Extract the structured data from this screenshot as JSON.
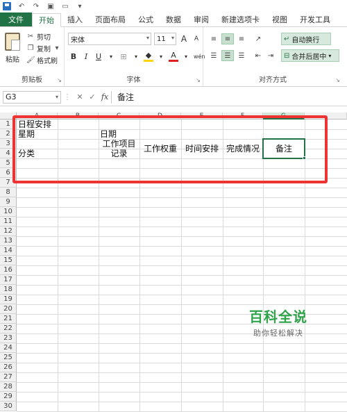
{
  "ribbon_tabs": [
    "文件",
    "开始",
    "插入",
    "页面布局",
    "公式",
    "数据",
    "审阅",
    "新建选项卡",
    "视图",
    "开发工具"
  ],
  "clipboard": {
    "paste_label": "粘贴",
    "cut_label": "剪切",
    "copy_label": "复制",
    "format_painter_label": "格式刷",
    "group_label": "剪贴板"
  },
  "font": {
    "font_name": "宋体",
    "font_size": "11",
    "bold": "B",
    "italic": "I",
    "underline": "U",
    "grow": "A",
    "shrink": "A",
    "font_color_glyph": "A",
    "phonetic": "wén",
    "group_label": "字体"
  },
  "alignment": {
    "wrap_text_label": "自动换行",
    "merge_center_label": "合并后居中",
    "group_label": "对齐方式"
  },
  "formula_bar": {
    "name_box": "G3",
    "cancel": "✕",
    "confirm": "✓",
    "fx": "fx",
    "content": "备注"
  },
  "grid": {
    "columns": [
      "A",
      "B",
      "C",
      "D",
      "E",
      "F",
      "G"
    ],
    "selected_column": "G",
    "rows": [
      "1",
      "2",
      "3",
      "4",
      "5",
      "6",
      "7",
      "8",
      "9",
      "10",
      "11",
      "12",
      "13",
      "14",
      "15",
      "16",
      "17",
      "18",
      "19",
      "20",
      "21",
      "22",
      "23",
      "24",
      "25",
      "26",
      "27",
      "28",
      "29",
      "30"
    ],
    "cells": {
      "A1": "日程安排",
      "A2": "星期",
      "A4": "分类",
      "C2": "日期",
      "C3": "工作项目记录",
      "D3": "工作权重",
      "E3": "时间安排",
      "F3": "完成情况",
      "G3": "备注"
    }
  },
  "watermark": {
    "title": "百科全说",
    "subtitle": "助你轻松解决"
  },
  "colors": {
    "excel_green": "#217346",
    "highlight_red": "#ee3333"
  }
}
